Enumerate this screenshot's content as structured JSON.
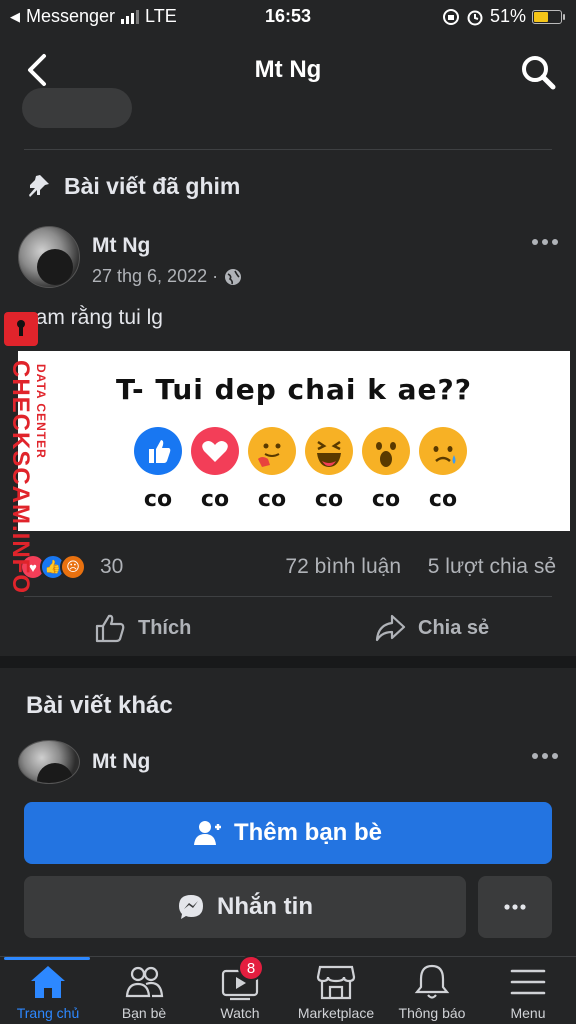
{
  "status_bar": {
    "carrier": "Messenger",
    "network": "LTE",
    "time": "16:53",
    "battery_percent": "51%",
    "battery_level": 0.51
  },
  "nav": {
    "title": "Mt Ng",
    "back_icon": "chevron-left-icon",
    "search_icon": "search-icon"
  },
  "pinned": {
    "header": "Bài viết đã ghim",
    "author": "Mt Ng",
    "date": "27 thg 6, 2022 ·",
    "text": "nam rằng tui lg",
    "image": {
      "caption": "T- Tui dep chai k ae??",
      "reactions": [
        "like",
        "love",
        "care",
        "haha",
        "wow",
        "sad"
      ],
      "labels": [
        "co",
        "co",
        "co",
        "co",
        "co",
        "co"
      ]
    },
    "reaction_count": "30",
    "comments": "72 bình luận",
    "shares": "5 lượt chia sẻ",
    "like_label": "Thích",
    "share_label": "Chia sẻ"
  },
  "watermark": {
    "brand": "CHECKSCAM.INFO",
    "subtitle": "DATA CENTER"
  },
  "other": {
    "title": "Bài viết khác",
    "author": "Mt Ng"
  },
  "actions": {
    "add_friend": "Thêm bạn bè",
    "message": "Nhắn tin"
  },
  "tabs": [
    {
      "label": "Trang chủ",
      "icon": "home-icon",
      "active": true
    },
    {
      "label": "Bạn bè",
      "icon": "friends-icon"
    },
    {
      "label": "Watch",
      "icon": "watch-icon",
      "badge": "8"
    },
    {
      "label": "Marketplace",
      "icon": "marketplace-icon"
    },
    {
      "label": "Thông báo",
      "icon": "bell-icon"
    },
    {
      "label": "Menu",
      "icon": "menu-icon"
    }
  ],
  "colors": {
    "background": "#18191a",
    "card": "#242526",
    "accent": "#2374e1",
    "badge": "#e41e3f",
    "watermark": "#e0242b"
  }
}
